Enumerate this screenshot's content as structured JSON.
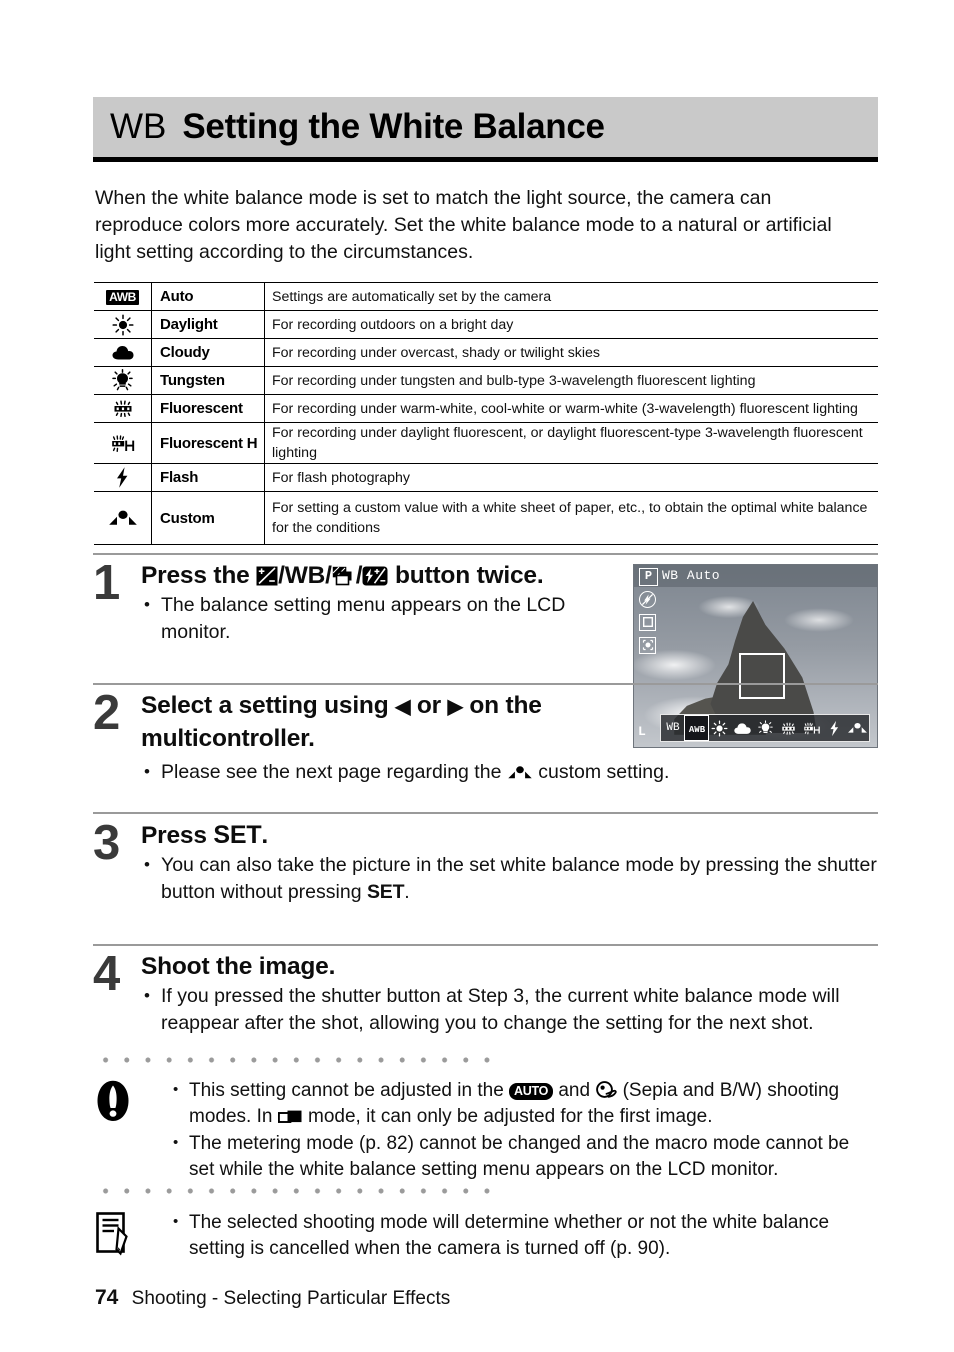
{
  "header": {
    "badge": "WB",
    "title": "Setting the White Balance"
  },
  "intro": "When the white balance mode is set to match the light source, the camera can reproduce colors more accurately. Set the white balance mode to a natural or artificial light setting according to the circumstances.",
  "table": {
    "rows": [
      {
        "icon": "awb-icon",
        "name": "Auto",
        "description": "Settings are automatically set by the camera"
      },
      {
        "icon": "daylight-sun-icon",
        "name": "Daylight",
        "description": "For recording outdoors on a bright day"
      },
      {
        "icon": "cloudy-cloud-icon",
        "name": "Cloudy",
        "description": "For recording under overcast, shady or twilight skies"
      },
      {
        "icon": "tungsten-bulb-icon",
        "name": "Tungsten",
        "description": "For recording under tungsten and bulb-type 3-wavelength fluorescent lighting"
      },
      {
        "icon": "fluorescent-tube-icon",
        "name": "Fluorescent",
        "description": "For recording under warm-white, cool-white or warm-white (3-wavelength) fluorescent lighting"
      },
      {
        "icon": "fluorescent-h-icon",
        "name": "Fluorescent H",
        "description": "For recording under daylight fluorescent, or daylight fluorescent-type 3-wavelength fluorescent lighting"
      },
      {
        "icon": "flash-bolt-icon",
        "name": "Flash",
        "description": "For flash photography"
      },
      {
        "icon": "custom-wb-icon",
        "name": "Custom",
        "description": "For setting a custom value with a white sheet of paper, etc., to obtain the optimal white balance for the conditions"
      }
    ]
  },
  "steps": [
    {
      "number": "1",
      "heading_parts": {
        "before": "Press the ",
        "sep1": "/",
        "wb": "WB",
        "sep2": "/",
        "sep3": "/",
        "after": " button twice."
      },
      "bullets": [
        "The balance setting menu appears on the LCD monitor."
      ]
    },
    {
      "number": "2",
      "heading_parts": {
        "before": "Select a setting using ",
        "left_arrow": "◀",
        "mid": " or ",
        "right_arrow": "▶",
        "after": " on the multicontroller."
      },
      "bullets": [
        "Please see the next page regarding the ",
        " custom setting."
      ]
    },
    {
      "number": "3",
      "heading_parts": {
        "before": "Press ",
        "set": "SET",
        "after": "."
      },
      "bullets": [
        "You can also take the picture in the set white balance mode by pressing the shutter button without pressing ",
        "SET",
        "."
      ]
    },
    {
      "number": "4",
      "heading_parts": {
        "before": "Shoot the image."
      },
      "bullets": [
        "If you pressed the shutter button at Step 3, the current white balance mode will reappear after the shot, allowing you to change the setting for the next shot."
      ]
    }
  ],
  "lcd": {
    "mode_badge": "P",
    "wb_status": "WB Auto",
    "wb_label": "WB",
    "quality_label": "L",
    "menu_items": [
      "awb-menu-icon",
      "daylight-menu-icon",
      "cloudy-menu-icon",
      "tungsten-menu-icon",
      "fluorescent-menu-icon",
      "fluorescent-h-menu-icon",
      "flash-menu-icon",
      "custom-menu-icon"
    ],
    "selected_index": 0
  },
  "caution": {
    "icon": "exclamation-icon",
    "items": [
      {
        "parts": [
          "This setting cannot be adjusted in the ",
          "AUTO",
          " and ",
          " (Sepia and B/W) shooting modes. In ",
          " mode, it can only be adjusted for the first image."
        ]
      },
      {
        "text": "The metering mode (p. 82) cannot be changed and the macro mode cannot be set while the white balance setting menu appears on the LCD monitor."
      }
    ]
  },
  "note": {
    "icon": "memo-pencil-icon",
    "items": [
      {
        "text": "The selected shooting mode will determine whether or not the white balance setting is cancelled when the camera is turned off (p. 90)."
      }
    ]
  },
  "footer": {
    "page_number": "74",
    "section": "Shooting - Selecting Particular Effects"
  },
  "colors": {
    "header_band": "#c9c9c9",
    "step_number": "#3a3a3a",
    "rule": "#9a9a9a",
    "dot": "#9b9b9b"
  }
}
